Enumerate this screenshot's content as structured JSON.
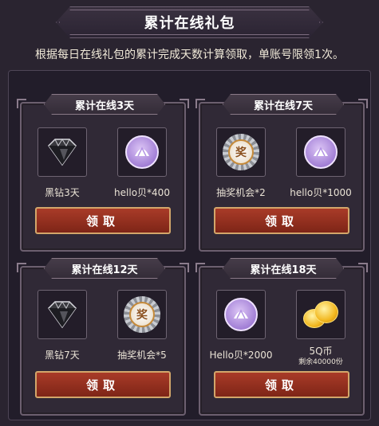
{
  "header": {
    "title": "累计在线礼包",
    "subtitle": "根据每日在线礼包的累计完成天数计算领取，单账号限领1次。"
  },
  "cards": [
    {
      "title": "累计在线3天",
      "rewards": [
        {
          "icon": "black-diamond-icon",
          "label": "黑钻3天"
        },
        {
          "icon": "hello-shell-coin-icon",
          "label": "hello贝*400"
        }
      ],
      "button": "领取"
    },
    {
      "title": "累计在线7天",
      "rewards": [
        {
          "icon": "lottery-ticket-icon",
          "label": "抽奖机会*2"
        },
        {
          "icon": "hello-shell-coin-icon",
          "label": "hello贝*1000"
        }
      ],
      "button": "领取"
    },
    {
      "title": "累计在线12天",
      "rewards": [
        {
          "icon": "black-diamond-icon",
          "label": "黑钻7天"
        },
        {
          "icon": "lottery-ticket-icon",
          "label": "抽奖机会*5"
        }
      ],
      "button": "领取"
    },
    {
      "title": "累计在线18天",
      "rewards": [
        {
          "icon": "hello-shell-coin-icon",
          "label": "Hello贝*2000"
        },
        {
          "icon": "gold-coins-icon",
          "label": "5Q币",
          "sub": "剩余40000份"
        }
      ],
      "button": "领取"
    }
  ],
  "icons": {
    "lottery_glyph": "奖"
  },
  "colors": {
    "background": "#2a2430",
    "button": "#a93b28",
    "button_border": "#d3a66a",
    "shell_coin": "#a27fd6"
  }
}
